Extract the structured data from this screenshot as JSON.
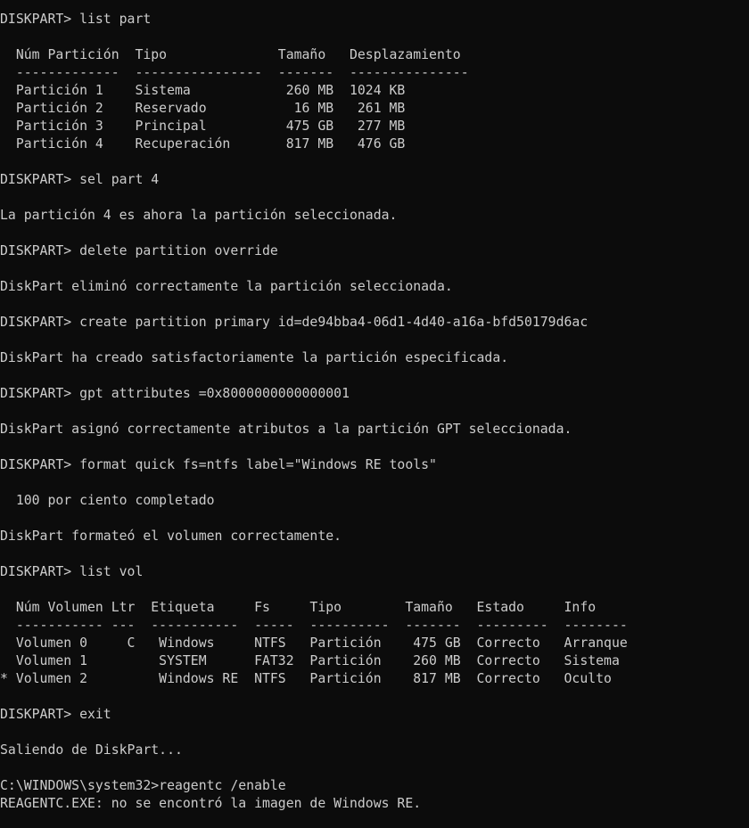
{
  "console": {
    "lines": [
      "DISKPART> list part",
      "",
      "  Núm Partición  Tipo              Tamaño   Desplazamiento",
      "  -------------  ----------------  -------  ---------------",
      "  Partición 1    Sistema            260 MB  1024 KB",
      "  Partición 2    Reservado           16 MB   261 MB",
      "  Partición 3    Principal          475 GB   277 MB",
      "  Partición 4    Recuperación       817 MB   476 GB",
      "",
      "DISKPART> sel part 4",
      "",
      "La partición 4 es ahora la partición seleccionada.",
      "",
      "DISKPART> delete partition override",
      "",
      "DiskPart eliminó correctamente la partición seleccionada.",
      "",
      "DISKPART> create partition primary id=de94bba4-06d1-4d40-a16a-bfd50179d6ac",
      "",
      "DiskPart ha creado satisfactoriamente la partición especificada.",
      "",
      "DISKPART> gpt attributes =0x8000000000000001",
      "",
      "DiskPart asignó correctamente atributos a la partición GPT seleccionada.",
      "",
      "DISKPART> format quick fs=ntfs label=\"Windows RE tools\"",
      "",
      "  100 por ciento completado",
      "",
      "DiskPart formateó el volumen correctamente.",
      "",
      "DISKPART> list vol",
      "",
      "  Núm Volumen Ltr  Etiqueta     Fs     Tipo        Tamaño   Estado     Info",
      "  ----------- ---  -----------  -----  ----------  -------  ---------  --------",
      "  Volumen 0     C   Windows     NTFS   Partición    475 GB  Correcto   Arranque",
      "  Volumen 1         SYSTEM      FAT32  Partición    260 MB  Correcto   Sistema",
      "* Volumen 2         Windows RE  NTFS   Partición    817 MB  Correcto   Oculto",
      "",
      "DISKPART> exit",
      "",
      "Saliendo de DiskPart...",
      "",
      "C:\\WINDOWS\\system32>reagentc /enable",
      "REAGENTC.EXE: no se encontró la imagen de Windows RE."
    ]
  },
  "colors": {
    "background": "#0c0c0c",
    "text": "#cccccc"
  }
}
